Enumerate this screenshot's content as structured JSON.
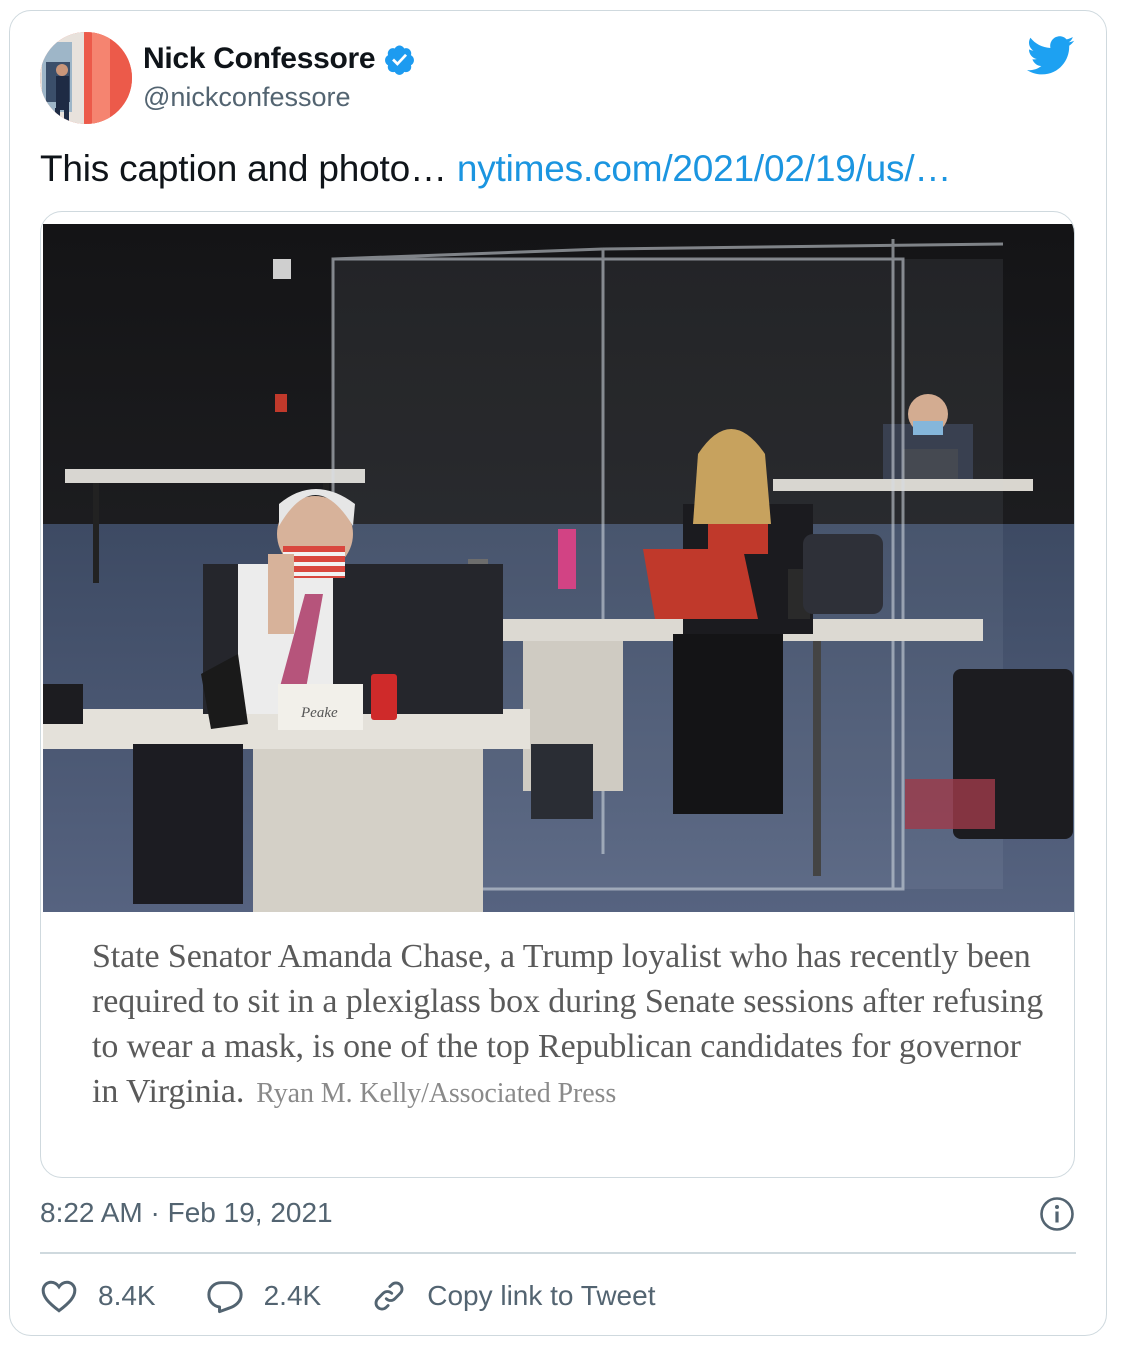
{
  "tweet": {
    "author_name": "Nick Confessore",
    "handle": "@nickconfessore",
    "text": "This caption and photo…",
    "link_text": "nytimes.com/2021/02/19/us/…",
    "timestamp": "8:22 AM · Feb 19, 2021"
  },
  "media": {
    "name_card": "Peake",
    "caption": "State Senator Amanda Chase, a Trump loyalist who has recently been required to sit in a plexiglass box during Senate sessions after refusing to wear a mask, is one of the top Republican candidates for governor in Virginia.",
    "credit": "Ryan M. Kelly/Associated Press"
  },
  "actions": {
    "likes": "8.4K",
    "replies": "2.4K",
    "copy_link": "Copy link to Tweet"
  },
  "colors": {
    "link": "#1b95e0",
    "verified": "#1d9bf0",
    "twitter_blue": "#1da1f2",
    "border": "#cfd9de",
    "secondary_text": "#536471"
  },
  "icons": [
    "verified-badge-icon",
    "twitter-bird-icon",
    "info-icon",
    "heart-icon",
    "reply-icon",
    "link-icon"
  ]
}
